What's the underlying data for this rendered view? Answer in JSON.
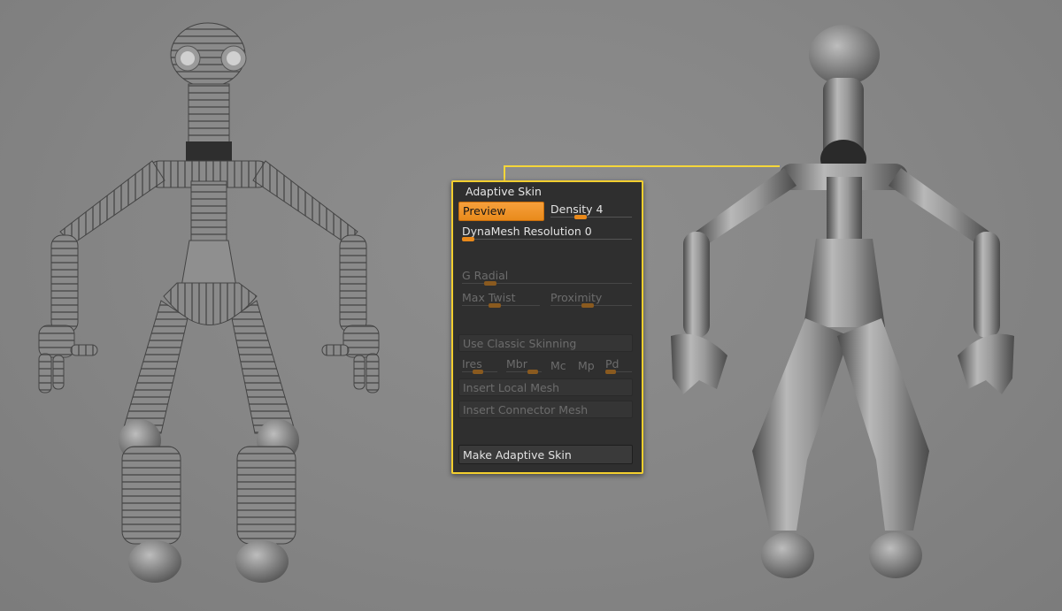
{
  "panel": {
    "title": "Adaptive Skin",
    "preview_label": "Preview",
    "density_label": "Density",
    "density_value": "4",
    "density_fraction": 0.35,
    "dynamesh_label": "DynaMesh Resolution",
    "dynamesh_value": "0",
    "dynamesh_fraction": 0.0,
    "g_radial_label": "G Radial",
    "g_radial_fraction": 0.14,
    "max_twist_label": "Max Twist",
    "max_twist_fraction": 0.4,
    "proximity_label": "Proximity",
    "proximity_fraction": 0.45,
    "classic_skinning_label": "Use Classic Skinning",
    "ires_label": "Ires",
    "mbr_label": "Mbr",
    "mc_label": "Mc",
    "mp_label": "Mp",
    "pd_label": "Pd",
    "insert_local_mesh_label": "Insert Local Mesh",
    "insert_connector_mesh_label": "Insert Connector Mesh",
    "make_adaptive_skin_label": "Make Adaptive Skin"
  },
  "colors": {
    "accent_orange": "#e98a1b",
    "callout_yellow": "#f3cf2f",
    "panel_bg": "#2f2f2f",
    "canvas_bg": "#858585"
  },
  "icons": {
    "left_model": "zsphere-figure-icon",
    "right_model": "adaptive-skin-mesh-icon"
  }
}
